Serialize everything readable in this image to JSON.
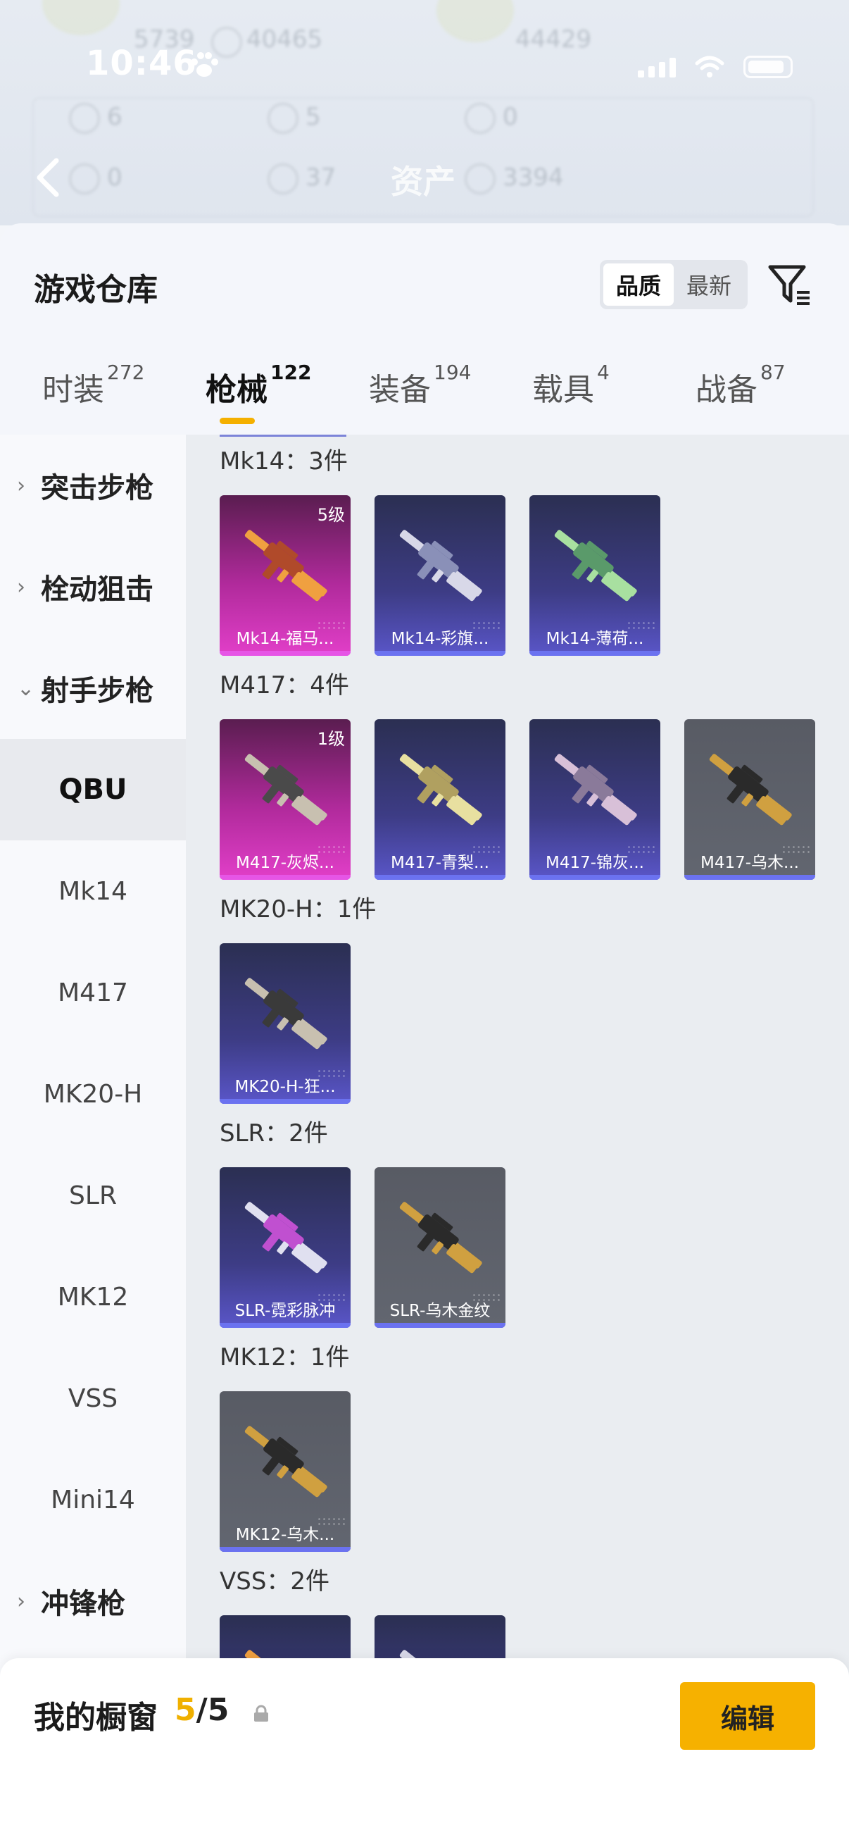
{
  "status_bar": {
    "time": "10:46"
  },
  "background": {
    "title": "资产",
    "stats": [
      "5739",
      "40465",
      "44429",
      "6",
      "5",
      "0",
      "0",
      "37",
      "3394"
    ]
  },
  "sheet": {
    "title": "游戏仓库",
    "sort": {
      "options": [
        "品质",
        "最新"
      ],
      "selected": "品质"
    }
  },
  "tabs": [
    {
      "label": "时装",
      "count": "272"
    },
    {
      "label": "枪械",
      "count": "122"
    },
    {
      "label": "装备",
      "count": "194"
    },
    {
      "label": "载具",
      "count": "4"
    },
    {
      "label": "战备",
      "count": "87"
    }
  ],
  "active_tab": "枪械",
  "nav": {
    "categories": [
      "突击步枪",
      "栓动狙击",
      "射手步枪",
      "冲锋枪"
    ],
    "subitems": [
      "QBU",
      "Mk14",
      "M417",
      "MK20-H",
      "SLR",
      "MK12",
      "VSS",
      "Mini14"
    ],
    "selected": "QBU"
  },
  "groups": [
    {
      "label": "Mk14：3件",
      "items": [
        {
          "name": "Mk14-福马...",
          "level": "5级",
          "rarity": "pink"
        },
        {
          "name": "Mk14-彩旗...",
          "rarity": "purple"
        },
        {
          "name": "Mk14-薄荷...",
          "rarity": "purple"
        }
      ]
    },
    {
      "label": "M417：4件",
      "items": [
        {
          "name": "M417-灰烬...",
          "level": "1级",
          "rarity": "pink"
        },
        {
          "name": "M417-青梨...",
          "rarity": "purple"
        },
        {
          "name": "M417-锦灰...",
          "rarity": "purple"
        },
        {
          "name": "M417-乌木...",
          "rarity": "gray"
        }
      ]
    },
    {
      "label": "MK20-H：1件",
      "items": [
        {
          "name": "MK20-H-狂...",
          "rarity": "purple"
        }
      ]
    },
    {
      "label": "SLR：2件",
      "items": [
        {
          "name": "SLR-霓彩脉冲",
          "rarity": "purple"
        },
        {
          "name": "SLR-乌木金纹",
          "rarity": "gray"
        }
      ]
    },
    {
      "label": "MK12：1件",
      "items": [
        {
          "name": "MK12-乌木...",
          "rarity": "gray"
        }
      ]
    },
    {
      "label": "VSS：2件",
      "items": []
    }
  ],
  "bottom": {
    "title": "我的橱窗",
    "count_current": "5",
    "count_sep_total": "/5",
    "edit_label": "编辑"
  },
  "colors": {
    "accent": "#f6b100",
    "pink_rarity": "#e23fc9",
    "purple_rarity": "#5a56c9",
    "gray_rarity": "#626670"
  }
}
